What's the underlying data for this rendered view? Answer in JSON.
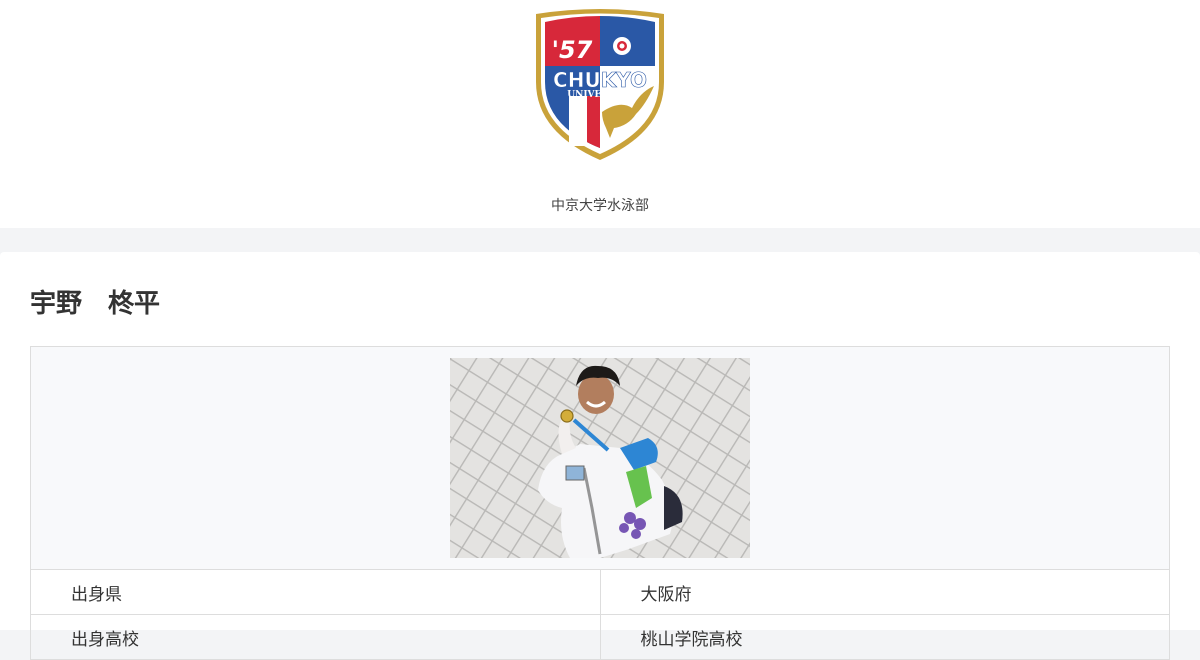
{
  "logo": {
    "text_year": "'57",
    "text_name": "CHUKYO",
    "text_sub": "UNIVERSITY",
    "colors": {
      "red": "#d7283a",
      "blue": "#2a58a6",
      "gold": "#c9a23a",
      "white": "#ffffff"
    }
  },
  "site": {
    "name": "中京大学水泳部"
  },
  "profile": {
    "name": "宇野　柊平",
    "photo_icon": "swimmer-holding-medal-photo",
    "rows": [
      {
        "label": "出身県",
        "value": "大阪府"
      },
      {
        "label": "出身高校",
        "value": "桃山学院高校"
      }
    ]
  }
}
